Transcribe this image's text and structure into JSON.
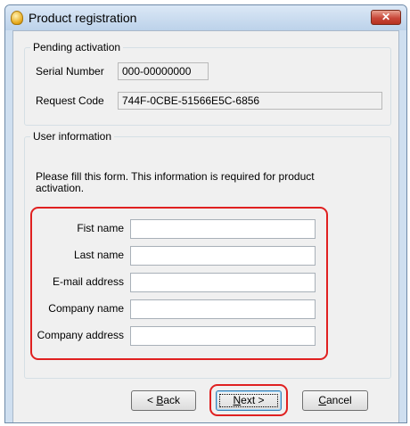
{
  "window": {
    "title": "Product registration",
    "close_symbol": "✕"
  },
  "pending": {
    "legend": "Pending activation",
    "serial_label": "Serial Number",
    "serial_value": "000-00000000",
    "request_label": "Request Code",
    "request_value": "744F-0CBE-51566E5C-6856"
  },
  "user_info": {
    "legend": "User information",
    "instructions": "Please fill this form. This information is required for product activation.",
    "fields": [
      {
        "label": "Fist name",
        "value": ""
      },
      {
        "label": "Last name",
        "value": ""
      },
      {
        "label": "E-mail address",
        "value": ""
      },
      {
        "label": "Company name",
        "value": ""
      },
      {
        "label": "Company address",
        "value": ""
      }
    ]
  },
  "buttons": {
    "back_prefix": "< ",
    "back_mnemonic": "B",
    "back_rest": "ack",
    "next_mnemonic": "N",
    "next_rest": "ext >",
    "cancel_mnemonic": "C",
    "cancel_rest": "ancel"
  },
  "colors": {
    "highlight": "#e02020",
    "title_gradient_top": "#dbe8f6",
    "client_bg": "#f0f0f0"
  }
}
